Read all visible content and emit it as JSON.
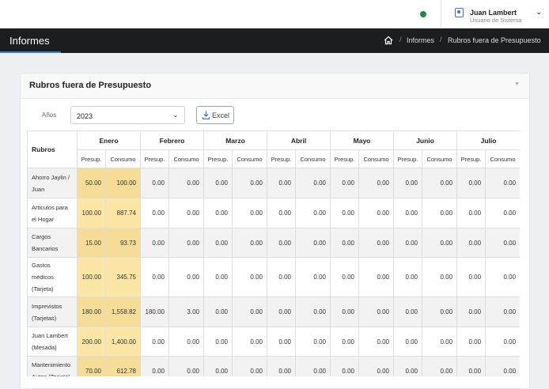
{
  "header": {
    "user_name": "Juan Lambert",
    "user_role": "Usuario de Sistema"
  },
  "titlebar": {
    "title": "Informes",
    "breadcrumb": [
      "Informes",
      "Rubros fuera de Presupuesto"
    ]
  },
  "card": {
    "title": "Rubros fuera de Presupuesto",
    "filter_label": "Años",
    "year_selected": "2023",
    "excel_label": "Excel"
  },
  "table": {
    "rubros_header": "Rubros",
    "months": [
      "Enero",
      "Febrero",
      "Marzo",
      "Abril",
      "Mayo",
      "Junio",
      "Julio"
    ],
    "sub_headers": [
      "Presup.",
      "Consumo"
    ],
    "rows": [
      {
        "rubro": "Ahorro Jaylin / Juan",
        "values": [
          "50.00",
          "100.00",
          "0.00",
          "0.00",
          "0.00",
          "0.00",
          "0.00",
          "0.00",
          "0.00",
          "0.00",
          "0.00",
          "0.00",
          "0.00",
          "0.00"
        ]
      },
      {
        "rubro": "Articulos para el Hogar",
        "values": [
          "100.00",
          "887.74",
          "0.00",
          "0.00",
          "0.00",
          "0.00",
          "0.00",
          "0.00",
          "0.00",
          "0.00",
          "0.00",
          "0.00",
          "0.00",
          "0.00"
        ]
      },
      {
        "rubro": "Cargos Bancarios",
        "values": [
          "15.00",
          "93.73",
          "0.00",
          "0.00",
          "0.00",
          "0.00",
          "0.00",
          "0.00",
          "0.00",
          "0.00",
          "0.00",
          "0.00",
          "0.00",
          "0.00"
        ]
      },
      {
        "rubro": "Gastos médicos (Tarjeta)",
        "values": [
          "100.00",
          "345.75",
          "0.00",
          "0.00",
          "0.00",
          "0.00",
          "0.00",
          "0.00",
          "0.00",
          "0.00",
          "0.00",
          "0.00",
          "0.00",
          "0.00"
        ]
      },
      {
        "rubro": "Imprevistos (Tarjetas)",
        "values": [
          "180.00",
          "1,558.82",
          "180.00",
          "3.00",
          "0.00",
          "0.00",
          "0.00",
          "0.00",
          "0.00",
          "0.00",
          "0.00",
          "0.00",
          "0.00",
          "0.00"
        ]
      },
      {
        "rubro": "Juan Lambert (Mesada)",
        "values": [
          "200.00",
          "1,400.00",
          "0.00",
          "0.00",
          "0.00",
          "0.00",
          "0.00",
          "0.00",
          "0.00",
          "0.00",
          "0.00",
          "0.00",
          "0.00",
          "0.00"
        ]
      },
      {
        "rubro": "Mantenimiento Autos (Tarjeta)",
        "values": [
          "70.00",
          "612.78",
          "0.00",
          "0.00",
          "0.00",
          "0.00",
          "0.00",
          "0.00",
          "0.00",
          "0.00",
          "0.00",
          "0.00",
          "0.00",
          "0.00"
        ]
      }
    ]
  },
  "colors": {
    "highlight": "#fbe6a6",
    "titlebar": "#1c1d1f",
    "accent": "#2f7fd8",
    "status": "#1f8a45"
  }
}
